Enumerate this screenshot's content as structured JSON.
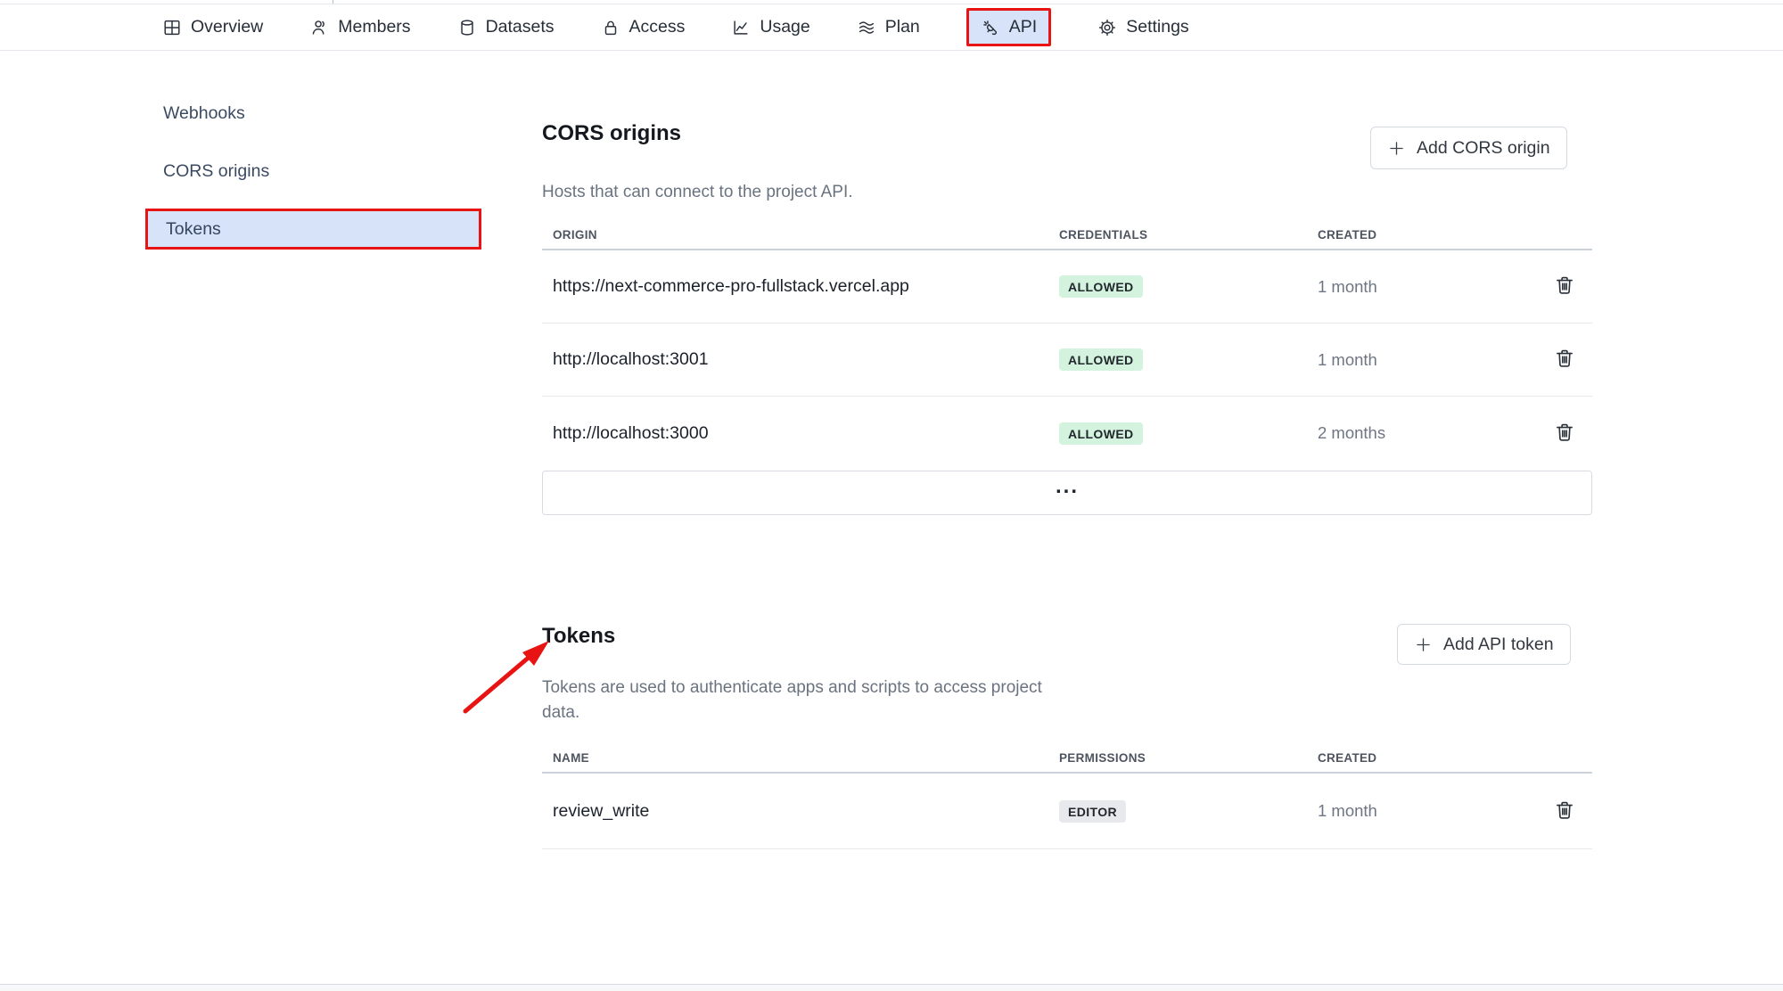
{
  "nav": {
    "items": [
      {
        "label": "Overview"
      },
      {
        "label": "Members"
      },
      {
        "label": "Datasets"
      },
      {
        "label": "Access"
      },
      {
        "label": "Usage"
      },
      {
        "label": "Plan"
      },
      {
        "label": "API",
        "active": true
      },
      {
        "label": "Settings"
      }
    ]
  },
  "sidebar": {
    "items": [
      {
        "label": "Webhooks"
      },
      {
        "label": "CORS origins"
      },
      {
        "label": "Tokens",
        "selected": true
      }
    ]
  },
  "cors": {
    "title": "CORS origins",
    "subtitle": "Hosts that can connect to the project API.",
    "add_button": "Add CORS origin",
    "columns": {
      "origin": "ORIGIN",
      "credentials": "CREDENTIALS",
      "created": "CREATED"
    },
    "rows": [
      {
        "origin": "https://next-commerce-pro-fullstack.vercel.app",
        "credentials": "ALLOWED",
        "created": "1 month"
      },
      {
        "origin": "http://localhost:3001",
        "credentials": "ALLOWED",
        "created": "1 month"
      },
      {
        "origin": "http://localhost:3000",
        "credentials": "ALLOWED",
        "created": "2 months"
      }
    ],
    "more_label": "..."
  },
  "tokens": {
    "title": "Tokens",
    "subtitle": "Tokens are used to authenticate apps and scripts to access project data.",
    "add_button": "Add API token",
    "columns": {
      "name": "NAME",
      "permissions": "PERMISSIONS",
      "created": "CREATED"
    },
    "rows": [
      {
        "name": "review_write",
        "permissions": "EDITOR",
        "created": "1 month"
      }
    ]
  },
  "colors": {
    "annotation_red": "#e81313",
    "selected_blue": "#d7e3f8",
    "badge_green_bg": "#d3f3de",
    "badge_gray_bg": "#e7e9ec"
  }
}
